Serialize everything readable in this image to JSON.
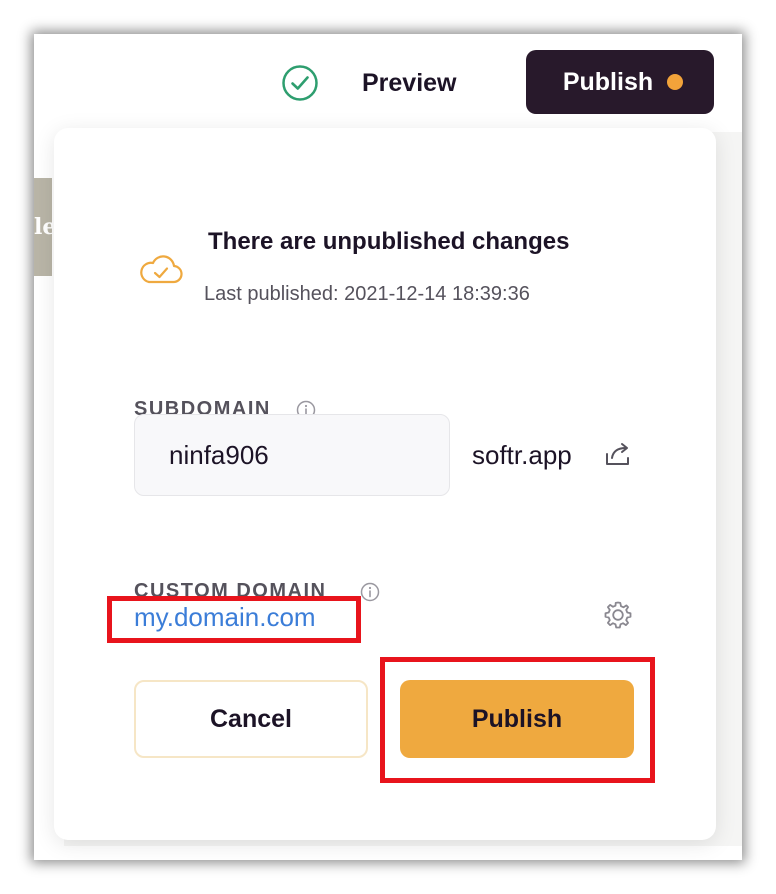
{
  "header": {
    "preview_label": "Preview",
    "publish_label": "Publish",
    "publish_dot_color": "#f2a33a",
    "check_icon": "check-circle-icon"
  },
  "background": {
    "tag_text": "le"
  },
  "popover": {
    "status_icon": "cloud-check-icon",
    "status_title": "There are unpublished changes",
    "last_published": "Last published: 2021-12-14 18:39:36",
    "subdomain": {
      "label": "SUBDOMAIN",
      "value": "ninfa906",
      "suffix": "softr.app",
      "info_icon": "info-icon",
      "open_icon": "external-link-icon"
    },
    "custom_domain": {
      "label": "CUSTOM DOMAIN",
      "value": "my.domain.com",
      "info_icon": "info-icon",
      "settings_icon": "gear-icon"
    },
    "actions": {
      "cancel_label": "Cancel",
      "publish_label": "Publish"
    }
  },
  "colors": {
    "accent": "#efa93f",
    "dark_button": "#28192b",
    "link": "#3b7dd8",
    "success": "#2e9e6f",
    "annotation": "#e8141c"
  }
}
